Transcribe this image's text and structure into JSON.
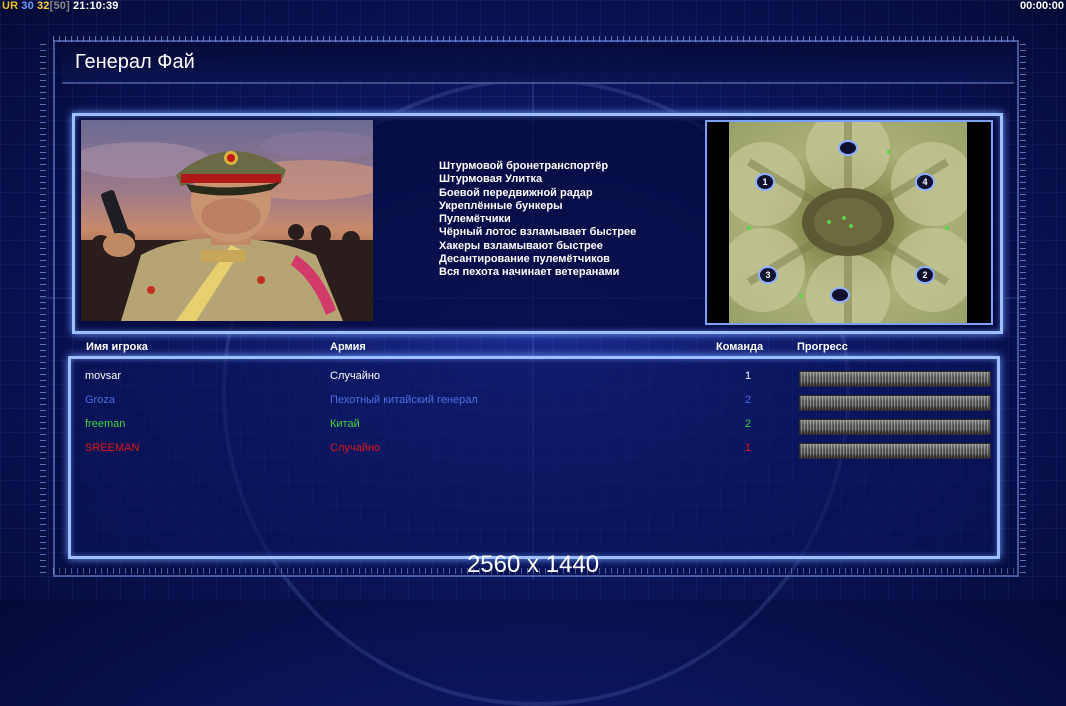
{
  "hud": {
    "ur": "UR",
    "fps": "30",
    "fps2": "32",
    "fps_bracket_open": "[",
    "fps_cap": "50",
    "fps_bracket_close": "]",
    "clock": "21:10:39",
    "timer": "00:00:00"
  },
  "general": {
    "name": "Генерал Фай",
    "powers": [
      "Штурмовой бронетранспортёр",
      "Штурмовая Улитка",
      "Боевой передвижной радар",
      "Укреплённые бункеры",
      "Пулемётчики",
      "Чёрный лотос взламывает быстрее",
      "Хакеры взламывают быстрее",
      "Десантирование пулемётчиков",
      "Вся пехота начинает ветеранами"
    ]
  },
  "minimap": {
    "slots": [
      "1",
      "4",
      "3",
      "2"
    ]
  },
  "table": {
    "headers": {
      "player": "Имя игрока",
      "army": "Армия",
      "team": "Команда",
      "progress": "Прогресс"
    },
    "players": [
      {
        "name": "movsar",
        "army": "Случайно",
        "team": "1",
        "color": "#ffffff"
      },
      {
        "name": "Groza",
        "army": "Пехотный китайский генерал",
        "team": "2",
        "color": "#4a6ee0"
      },
      {
        "name": "freeman",
        "army": "Китай",
        "team": "2",
        "color": "#3fd23f"
      },
      {
        "name": "SREEMAN",
        "army": "Случайно",
        "team": "1",
        "color": "#e01818"
      }
    ]
  },
  "resolution": "2560 x 1440"
}
